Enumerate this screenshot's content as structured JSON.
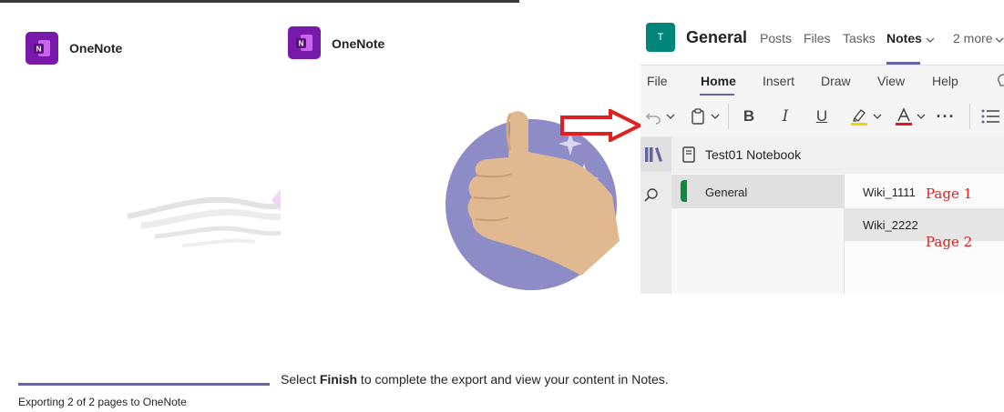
{
  "export_panel": {
    "app_name_1": "OneNote",
    "app_name_2": "OneNote",
    "progress_text": "Exporting 2 of 2 pages to OneNote",
    "progress_value": 1.0,
    "finish_pre": "Select ",
    "finish_bold": "Finish",
    "finish_post": " to complete the export and view your content in Notes."
  },
  "teams": {
    "avatar_letter": "T",
    "channel_title": "General",
    "tabs": [
      "Posts",
      "Files",
      "Tasks",
      "Notes",
      "2 more"
    ],
    "active_tab": "Notes"
  },
  "ribbon": {
    "tabs": [
      "File",
      "Home",
      "Insert",
      "Draw",
      "View",
      "Help"
    ],
    "active_tab": "Home",
    "highlight_color": "#f2d600",
    "font_color": "#e81123",
    "accent_color": "#6264a7"
  },
  "notebook": {
    "title": "Test01 Notebook",
    "section": "General",
    "section_color": "#0e8a3f",
    "pages": [
      "Wiki_1111",
      "Wiki_2222"
    ]
  },
  "annotations": {
    "page1": "Page 1",
    "page2": "Page 2"
  },
  "colors": {
    "onenote_purple": "#7719aa",
    "arrow_red": "#e02020",
    "illustration_circle": "#8e8cc6"
  }
}
